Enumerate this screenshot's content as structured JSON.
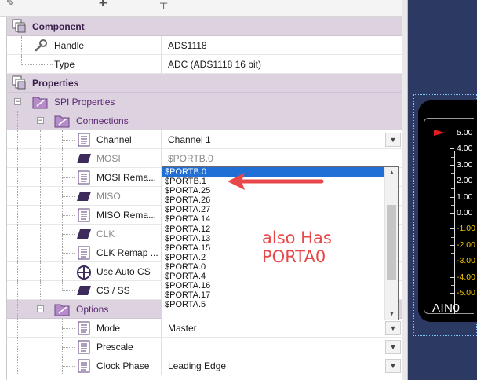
{
  "colors": {
    "accent": "#1f6fd6",
    "annotation": "#e8484a",
    "category_bg": "#dcd2e0",
    "canvas_bg": "#2c3a63",
    "meter_positive": "#ffffff",
    "meter_negative": "#f2c300",
    "needle": "#e21d1d"
  },
  "grid": {
    "component": {
      "label": "Component",
      "icon": "component-icon",
      "rows": [
        {
          "label": "Handle",
          "value": "ADS1118",
          "icon": "wrench-icon"
        },
        {
          "label": "Type",
          "value": "ADC (ADS1118 16 bit)",
          "icon": ""
        }
      ]
    },
    "properties": {
      "label": "Properties",
      "icon": "properties-icon",
      "spi": {
        "label": "SPI Properties"
      },
      "connections": {
        "label": "Connections",
        "rows": [
          {
            "label": "Channel",
            "value": "Channel 1"
          },
          {
            "label": "MOSI",
            "value": "$PORTB.0"
          },
          {
            "label": "MOSI Rema...",
            "value": ""
          },
          {
            "label": "MISO",
            "value": ""
          },
          {
            "label": "MISO Rema...",
            "value": ""
          },
          {
            "label": "CLK",
            "value": ""
          },
          {
            "label": "CLK Remap ...",
            "value": ""
          },
          {
            "label": "Use Auto CS",
            "value": ""
          },
          {
            "label": "CS / SS",
            "value": ""
          }
        ]
      },
      "options": {
        "label": "Options",
        "rows": [
          {
            "label": "Mode",
            "value": "Master"
          },
          {
            "label": "Prescale",
            "value": ""
          },
          {
            "label": "Clock Phase",
            "value": "Leading Edge"
          }
        ]
      }
    }
  },
  "dropdown": {
    "selected": "$PORTB.0",
    "options": [
      "$PORTB.0",
      "$PORTB.1",
      "$PORTA.25",
      "$PORTA.26",
      "$PORTA.27",
      "$PORTA.14",
      "$PORTA.12",
      "$PORTA.13",
      "$PORTA.15",
      "$PORTA.2",
      "$PORTA.0",
      "$PORTA.4",
      "$PORTA.16",
      "$PORTA.17",
      "$PORTA.5"
    ]
  },
  "annotation": {
    "line1": "also Has",
    "line2": "PORTA0"
  },
  "meter": {
    "label": "AIN0",
    "needle_value": 5.0,
    "ticks": [
      "5.00",
      "4.00",
      "3.00",
      "2.00",
      "1.00",
      "0.00",
      "-1.00",
      "-2.00",
      "-3.00",
      "-4.00",
      "-5.00"
    ]
  }
}
